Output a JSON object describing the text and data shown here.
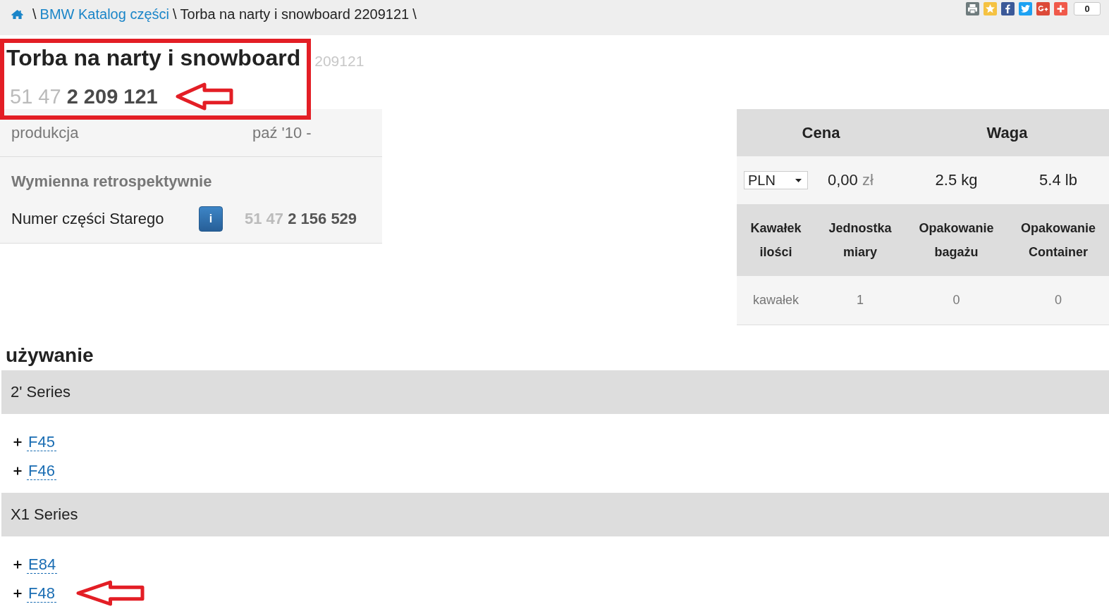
{
  "breadcrumb": [
    {
      "kind": "home"
    },
    {
      "kind": "separator",
      "text": "\\"
    },
    {
      "kind": "link",
      "text": "BMW Katalog części"
    },
    {
      "kind": "separator",
      "text": "\\"
    },
    {
      "kind": "current",
      "text": "Torba na narty i snowboard 2209121"
    },
    {
      "kind": "separator",
      "text": "\\"
    }
  ],
  "share_buttons": [
    {
      "kind": "print",
      "color": "#6e7b7d"
    },
    {
      "kind": "bookmark",
      "color": "#f5c242"
    },
    {
      "kind": "facebook",
      "color": "#3b5998"
    },
    {
      "kind": "twitter",
      "color": "#1da1f2"
    },
    {
      "kind": "google_plus",
      "color": "#dc4a38"
    },
    {
      "kind": "more",
      "color": "#f0594a"
    }
  ],
  "share_count": "0",
  "title_block": {
    "highlighted": true,
    "title": "Torba na narty i snowboard",
    "title_number": "209121",
    "part_number": {
      "prefix": "51 47",
      "main": "2 209 121",
      "arrow": true
    }
  },
  "details": {
    "production": {
      "label": "produkcja",
      "value": "paź '10 -"
    },
    "interchange": {
      "heading": "Wymienna retrospektywnie",
      "label": "Numer części Starego",
      "info_button": "i",
      "old_number": {
        "prefix": "51 47",
        "main": "2 156 529"
      }
    }
  },
  "price_table": {
    "headers": [
      "Cena",
      "Waga"
    ],
    "currency": "PLN",
    "price": {
      "amount": "0,00",
      "unit": "zł"
    },
    "weights": [
      "2.5 kg",
      "5.4 lb"
    ],
    "columns": [
      "Kawałek ilości",
      "Jednostka miary",
      "Opakowanie bagażu",
      "Opakowanie Container"
    ],
    "row": [
      "kawałek",
      "1",
      "0",
      "0"
    ]
  },
  "usage": {
    "heading": "używanie",
    "series": [
      {
        "name": "2' Series",
        "models": [
          {
            "label": "F45",
            "arrow": false
          },
          {
            "label": "F46",
            "arrow": false
          }
        ]
      },
      {
        "name": "X1 Series",
        "models": [
          {
            "label": "E84",
            "arrow": false
          },
          {
            "label": "F48",
            "arrow": true
          }
        ]
      }
    ]
  }
}
